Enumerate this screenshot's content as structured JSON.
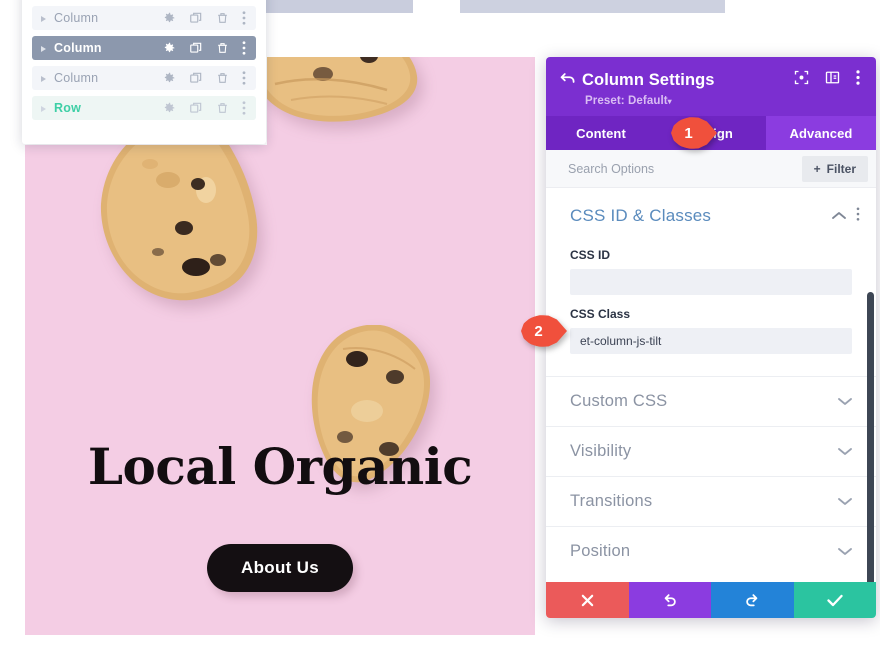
{
  "layers_panel": {
    "rows": [
      {
        "label": "Column",
        "state": "normal"
      },
      {
        "label": "Column",
        "state": "selected"
      },
      {
        "label": "Column",
        "state": "normal"
      },
      {
        "label": "Row",
        "state": "row"
      }
    ],
    "icons": {
      "expand": "caret-right-icon",
      "settings": "gear-icon",
      "duplicate": "duplicate-icon",
      "delete": "trash-icon",
      "more": "more-vertical-icon"
    }
  },
  "hero": {
    "heading": "Local Organic",
    "cta_label": "About Us",
    "background_color": "#f4cde4",
    "heading_color": "#120d10",
    "cta_background": "#140f12"
  },
  "settings": {
    "title": "Column Settings",
    "preset_label": "Preset: Default",
    "preset_caret": "▾",
    "header_icons": [
      "focus-icon",
      "layout-icon",
      "more-vertical-icon"
    ],
    "back_icon": "back-arrow-icon",
    "tabs": [
      {
        "label": "Content",
        "active": false
      },
      {
        "label": "Design",
        "active": false
      },
      {
        "label": "Advanced",
        "active": true
      }
    ],
    "search": {
      "placeholder": "Search Options",
      "value": ""
    },
    "filter_button": {
      "label": "Filter",
      "plus": "+"
    },
    "open_section": {
      "title": "CSS ID & Classes",
      "collapse_icon": "chevron-up-icon",
      "more_icon": "more-vertical-icon",
      "fields": [
        {
          "label": "CSS ID",
          "value": "",
          "placeholder": ""
        },
        {
          "label": "CSS Class",
          "value": "et-column-js-tilt",
          "placeholder": ""
        }
      ]
    },
    "accordions": [
      {
        "label": "Custom CSS",
        "icon": "chevron-down-icon"
      },
      {
        "label": "Visibility",
        "icon": "chevron-down-icon"
      },
      {
        "label": "Transitions",
        "icon": "chevron-down-icon"
      },
      {
        "label": "Position",
        "icon": "chevron-down-icon"
      }
    ],
    "footer_buttons": [
      {
        "name": "discard",
        "icon": "close-icon",
        "color": "#eb5a5a"
      },
      {
        "name": "undo",
        "icon": "undo-icon",
        "color": "#8b3ce0"
      },
      {
        "name": "redo",
        "icon": "redo-icon",
        "color": "#2383d8"
      },
      {
        "name": "save",
        "icon": "check-icon",
        "color": "#2bc4a0"
      }
    ],
    "accent_color": "#7b2fd0"
  },
  "markers": [
    {
      "number": "1",
      "target": "advanced-tab"
    },
    {
      "number": "2",
      "target": "css-class-field"
    }
  ]
}
